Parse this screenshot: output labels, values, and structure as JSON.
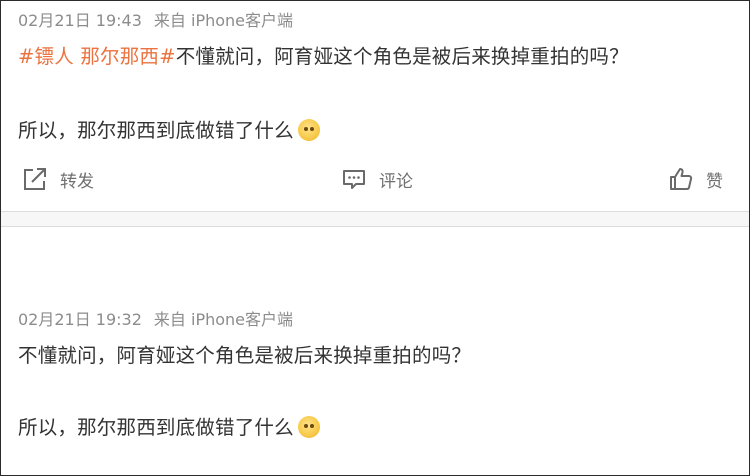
{
  "post1": {
    "timestamp": "02月21日 19:43",
    "source": "来自 iPhone客户端",
    "tag": "#镖人 那尔那西#",
    "line1": "不懂就问，阿育娅这个角色是被后来换掉重拍的吗？",
    "line2": "所以，那尔那西到底做错了什么",
    "emoji": "pray-emoji"
  },
  "actions": {
    "repost_label": "转发",
    "comment_label": "评论",
    "like_label": "赞",
    "repost_icon": "share-arrow-icon",
    "comment_icon": "comment-bubble-icon",
    "like_icon": "thumbs-up-icon"
  },
  "post2": {
    "timestamp": "02月21日 19:32",
    "source": "来自 iPhone客户端",
    "line1": "不懂就问，阿育娅这个角色是被后来换掉重拍的吗？",
    "line2": "所以，那尔那西到底做错了什么",
    "emoji": "pray-emoji"
  },
  "colors": {
    "tag": "#eb7340",
    "meta": "#8c8c8c",
    "text": "#333333",
    "action": "#707070"
  }
}
